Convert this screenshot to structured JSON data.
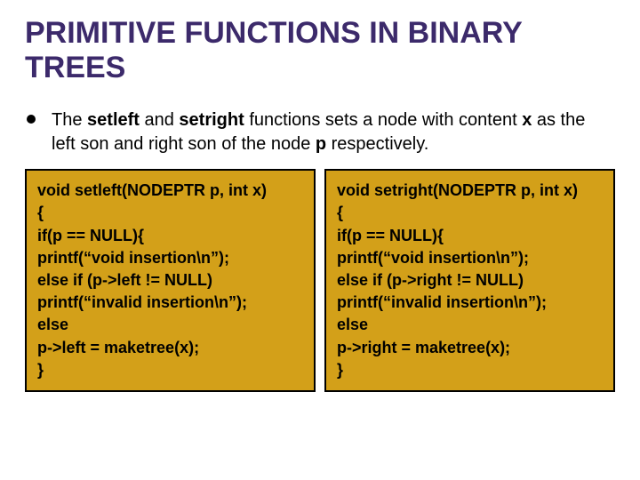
{
  "title": "PRIMITIVE FUNCTIONS IN BINARY TREES",
  "paragraph": {
    "pre1": "The ",
    "b1": "setleft",
    "mid1": " and ",
    "b2": "setright",
    "mid2": " functions sets a node with content ",
    "b3": "x",
    "mid3": " as the left son and right son of the node ",
    "b4": "p",
    "post": " respectively."
  },
  "code_left": "void setleft(NODEPTR p, int x)\n{\nif(p == NULL){\nprintf(“void insertion\\n”);\nelse if (p->left != NULL)\nprintf(“invalid insertion\\n”);\nelse\np->left = maketree(x);\n}",
  "code_right": "void setright(NODEPTR p, int x)\n{\nif(p == NULL){\nprintf(“void insertion\\n”);\nelse if (p->right != NULL)\nprintf(“invalid insertion\\n”);\nelse\np->right = maketree(x);\n}"
}
